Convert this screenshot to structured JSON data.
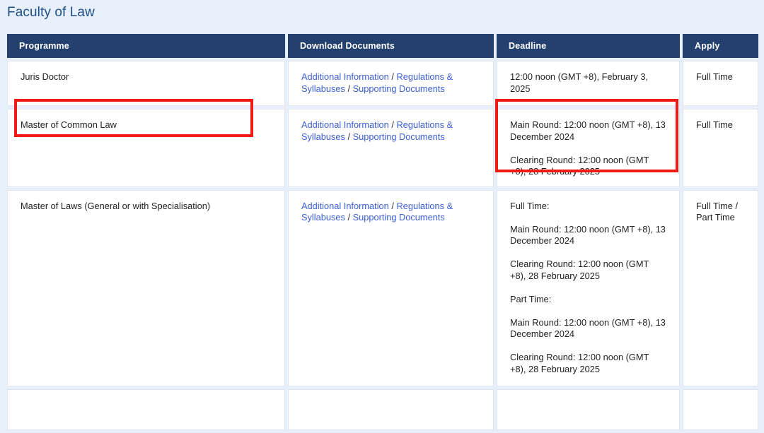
{
  "page": {
    "title": "Faculty of Law",
    "background_color": "#e7f0fa",
    "title_color": "#1f4e87",
    "header_color": "#23406e",
    "link_color": "#3b5fd6",
    "highlight_color": "#f01b15"
  },
  "table": {
    "columns": [
      {
        "key": "programme",
        "label": "Programme"
      },
      {
        "key": "documents",
        "label": "Download Documents"
      },
      {
        "key": "deadline",
        "label": "Deadline"
      },
      {
        "key": "apply",
        "label": "Apply"
      }
    ],
    "rows": [
      {
        "programme": "Juris Doctor",
        "documents": [
          {
            "label": "Additional Information",
            "type": "link"
          },
          {
            "label": "/",
            "type": "separator"
          },
          {
            "label": "Regulations & Syllabuses",
            "type": "link"
          },
          {
            "label": "/",
            "type": "separator"
          },
          {
            "label": "Supporting Documents",
            "type": "link"
          }
        ],
        "deadline": [
          "12:00 noon (GMT +8), February 3, 2025"
        ],
        "apply": [
          "Full Time"
        ],
        "highlighted_programme": false,
        "highlighted_deadline": false
      },
      {
        "programme": "Master of Common Law",
        "documents": [
          {
            "label": "Additional Information",
            "type": "link"
          },
          {
            "label": "/",
            "type": "separator"
          },
          {
            "label": "Regulations & Syllabuses",
            "type": "link"
          },
          {
            "label": "/",
            "type": "separator"
          },
          {
            "label": "Supporting Documents",
            "type": "link"
          }
        ],
        "deadline": [
          "Main Round: 12:00 noon (GMT +8), 13 December 2024",
          "Clearing Round: 12:00 noon (GMT +8), 28 February 2025"
        ],
        "apply": [
          "Full Time"
        ],
        "highlighted_programme": true,
        "highlighted_deadline": true
      },
      {
        "programme": "Master of Laws (General or with Specialisation)",
        "documents": [
          {
            "label": "Additional Information",
            "type": "link"
          },
          {
            "label": "/",
            "type": "separator"
          },
          {
            "label": "Regulations & Syllabuses",
            "type": "link"
          },
          {
            "label": "/",
            "type": "separator"
          },
          {
            "label": "Supporting Documents",
            "type": "link"
          }
        ],
        "deadline": [
          "Full Time:",
          "Main Round: 12:00 noon (GMT +8), 13 December 2024",
          "Clearing Round: 12:00 noon (GMT +8), 28 February 2025",
          "Part Time:",
          "Main Round: 12:00 noon (GMT +8), 13 December 2024",
          "Clearing Round: 12:00 noon (GMT +8), 28 February 2025"
        ],
        "apply": [
          "Full Time /",
          "Part Time"
        ],
        "highlighted_programme": false,
        "highlighted_deadline": false
      },
      {
        "programme": "",
        "documents": [],
        "deadline": [],
        "apply": [],
        "highlighted_programme": false,
        "highlighted_deadline": false
      }
    ]
  }
}
